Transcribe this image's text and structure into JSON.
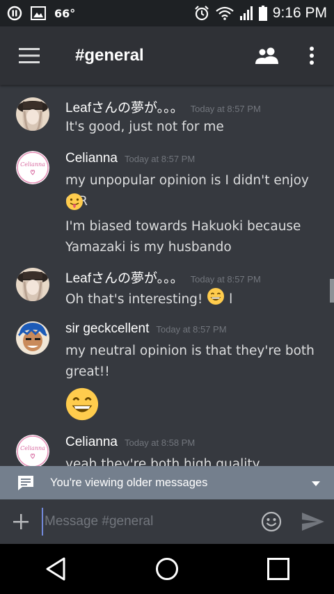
{
  "status_bar": {
    "temperature": "66°",
    "time": "9:16 PM"
  },
  "header": {
    "channel_title": "#general"
  },
  "messages": [
    {
      "author": "Leafさんの夢が。。。",
      "timestamp": "Today at 8:57 PM",
      "lines": [
        "It's good, just not for me"
      ]
    },
    {
      "author": "Celianna",
      "timestamp": "Today at 8:57 PM",
      "lines": [
        "my unpopular opinion is I didn't enjoy C:R",
        "I'm biased towards Hakuoki because Yamazaki is my husbando"
      ]
    },
    {
      "author": "Leafさんの夢が。。。",
      "timestamp": "Today at 8:57 PM",
      "lines": [
        "Oh that's interesting!",
        "l"
      ]
    },
    {
      "author": "sir geckcellent",
      "timestamp": "Today at 8:57 PM",
      "lines": [
        "my neutral opinion is that they're both great!!"
      ]
    },
    {
      "author": "Celianna",
      "timestamp": "Today at 8:58 PM",
      "lines": [
        "yeah they're both high quality"
      ]
    }
  ],
  "older_bar": {
    "label": "You're viewing older messages"
  },
  "composer": {
    "placeholder": "Message #general"
  },
  "colors": {
    "background": "#36393f",
    "header": "#2f3136",
    "older_bar": "#747f8d",
    "accent": "#7289da",
    "emoji_yellow": "#ffcc4d"
  },
  "icons": [
    "pause-icon",
    "image-icon",
    "alarm-icon",
    "wifi-icon",
    "signal-icon",
    "battery-icon",
    "menu-icon",
    "members-icon",
    "more-icon",
    "chat-bubble-icon",
    "chevron-down-icon",
    "plus-icon",
    "emoji-icon",
    "send-icon",
    "back-icon",
    "home-icon",
    "recents-icon"
  ]
}
